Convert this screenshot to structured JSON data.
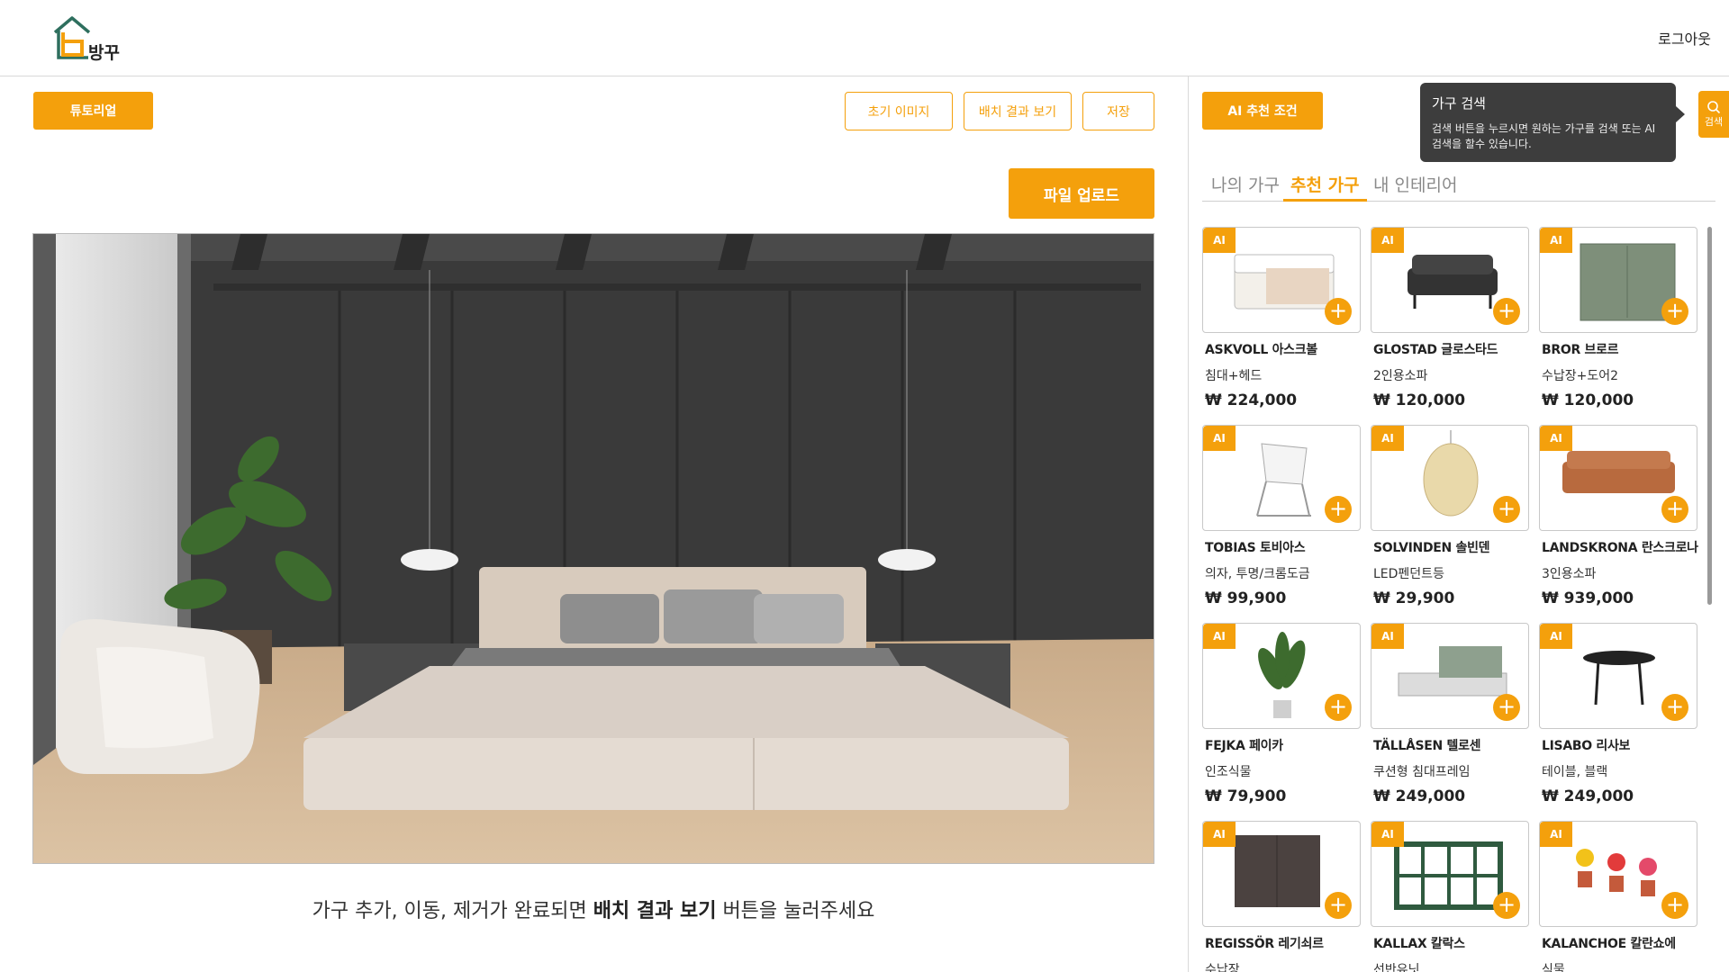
{
  "header": {
    "brand": "방꾸",
    "logout": "로그아웃"
  },
  "toolbar": {
    "tutorial": "튜토리얼",
    "initial_image": "초기 이미지",
    "view_result": "배치 결과 보기",
    "save": "저장",
    "upload": "파일 업로드"
  },
  "instruction": {
    "before": "가구 추가, 이동, 제거가 완료되면 ",
    "bold": "배치 결과 보기",
    "after": " 버튼을 눌러주세요"
  },
  "right_panel": {
    "ai_conditions": "AI 추천 조건",
    "tooltip_title": "가구 검색",
    "tooltip_body": "검색 버튼을 누르시면 원하는 가구를 검색 또는 AI 검색을 할수 있습니다.",
    "search_label": "검색",
    "tabs": [
      "나의 가구",
      "추천 가구",
      "내 인테리어"
    ],
    "active_tab": 1
  },
  "products": [
    {
      "badge": "AI",
      "name": "ASKVOLL 아스크볼",
      "sub": "침대+헤드",
      "price": "₩ 224,000",
      "icon": "bed-icon"
    },
    {
      "badge": "AI",
      "name": "GLOSTAD 글로스타드",
      "sub": "2인용소파",
      "price": "₩ 120,000",
      "icon": "sofa-icon"
    },
    {
      "badge": "AI",
      "name": "BROR 브로르",
      "sub": "수납장+도어2",
      "price": "₩ 120,000",
      "icon": "cabinet-icon"
    },
    {
      "badge": "AI",
      "name": "TOBIAS 토비아스",
      "sub": "의자, 투명/크롬도금",
      "price": "₩ 99,900",
      "icon": "chair-icon"
    },
    {
      "badge": "AI",
      "name": "SOLVINDEN 솔빈덴",
      "sub": "LED펜던트등",
      "price": "₩ 29,900",
      "icon": "lamp-icon"
    },
    {
      "badge": "AI",
      "name": "LANDSKRONA 란스크로나",
      "sub": "3인용소파",
      "price": "₩ 939,000",
      "icon": "leather-sofa-icon"
    },
    {
      "badge": "AI",
      "name": "FEJKA 페이카",
      "sub": "인조식물",
      "price": "₩ 79,900",
      "icon": "plant-icon"
    },
    {
      "badge": "AI",
      "name": "TÄLLÅSEN 텔로센",
      "sub": "쿠션형 침대프레임",
      "price": "₩ 249,000",
      "icon": "bed-frame-icon"
    },
    {
      "badge": "AI",
      "name": "LISABO 리사보",
      "sub": "테이블, 블랙",
      "price": "₩ 249,000",
      "icon": "table-icon"
    },
    {
      "badge": "AI",
      "name": "REGISSÖR 레기쇠르",
      "sub": "수납장",
      "price": "",
      "icon": "sideboard-icon"
    },
    {
      "badge": "AI",
      "name": "KALLAX 칼락스",
      "sub": "선반유닛",
      "price": "",
      "icon": "shelf-icon"
    },
    {
      "badge": "AI",
      "name": "KALANCHOE 칼란쇼에",
      "sub": "식물",
      "price": "",
      "icon": "flowers-icon"
    }
  ],
  "colors": {
    "accent": "#f4a00c",
    "logo_green": "#2e6f5e",
    "wall": "#3a3a3a"
  }
}
